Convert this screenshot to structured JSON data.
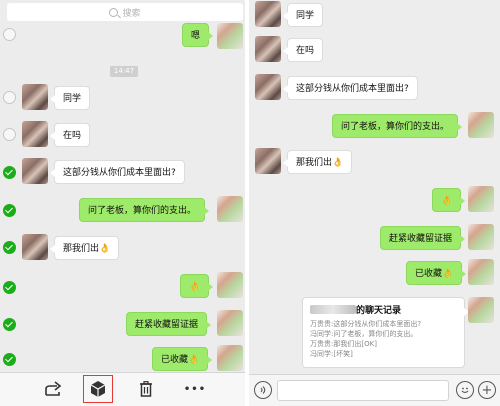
{
  "left": {
    "search_placeholder": "搜索",
    "time_label": "14:47",
    "messages": [
      {
        "text": "嗯",
        "dir": "out"
      },
      {
        "text": "同学",
        "dir": "in"
      },
      {
        "text": "在吗",
        "dir": "in"
      },
      {
        "text": "这部分钱从你们成本里面出?",
        "dir": "in"
      },
      {
        "text": "问了老板，算你们的支出。",
        "dir": "out"
      },
      {
        "text": "那我们出👌",
        "dir": "in"
      },
      {
        "text": "👌",
        "dir": "out"
      },
      {
        "text": "赶紧收藏留证据",
        "dir": "out"
      },
      {
        "text": "已收藏👌",
        "dir": "out"
      }
    ],
    "toolbar": {
      "items": [
        "share",
        "favorite",
        "delete",
        "more"
      ],
      "icons": [
        "share-icon",
        "cube-icon",
        "trash-icon",
        "more-icon"
      ],
      "more_label": "•••",
      "selected": "favorite"
    }
  },
  "right": {
    "messages": [
      {
        "text": "同学",
        "dir": "in"
      },
      {
        "text": "在吗",
        "dir": "in"
      },
      {
        "text": "这部分钱从你们成本里面出?",
        "dir": "in"
      },
      {
        "text": "问了老板，算你们的支出。",
        "dir": "out"
      },
      {
        "text": "那我们出👌",
        "dir": "in"
      },
      {
        "text": "👌",
        "dir": "out"
      },
      {
        "text": "赶紧收藏留证据",
        "dir": "out"
      },
      {
        "text": "已收藏👌",
        "dir": "out"
      }
    ],
    "record": {
      "title_suffix": "的聊天记录",
      "lines": [
        "万贵贵:这部分钱从你们成本里面出?",
        "冯同学:问了老板，算你们的支出。",
        "万贵贵:那我们出[OK]",
        "冯同学:[坏笑]"
      ]
    },
    "input_bar": {
      "voice_icon": "voice-icon",
      "emoji_icon": "emoji-icon",
      "plus_label": "+"
    }
  },
  "colors": {
    "outgoing_bubble": "#9eea6a",
    "incoming_bubble": "#ffffff",
    "check_green": "#1aad19",
    "chat_background": "#ececec",
    "selection_outline": "#e53935"
  }
}
